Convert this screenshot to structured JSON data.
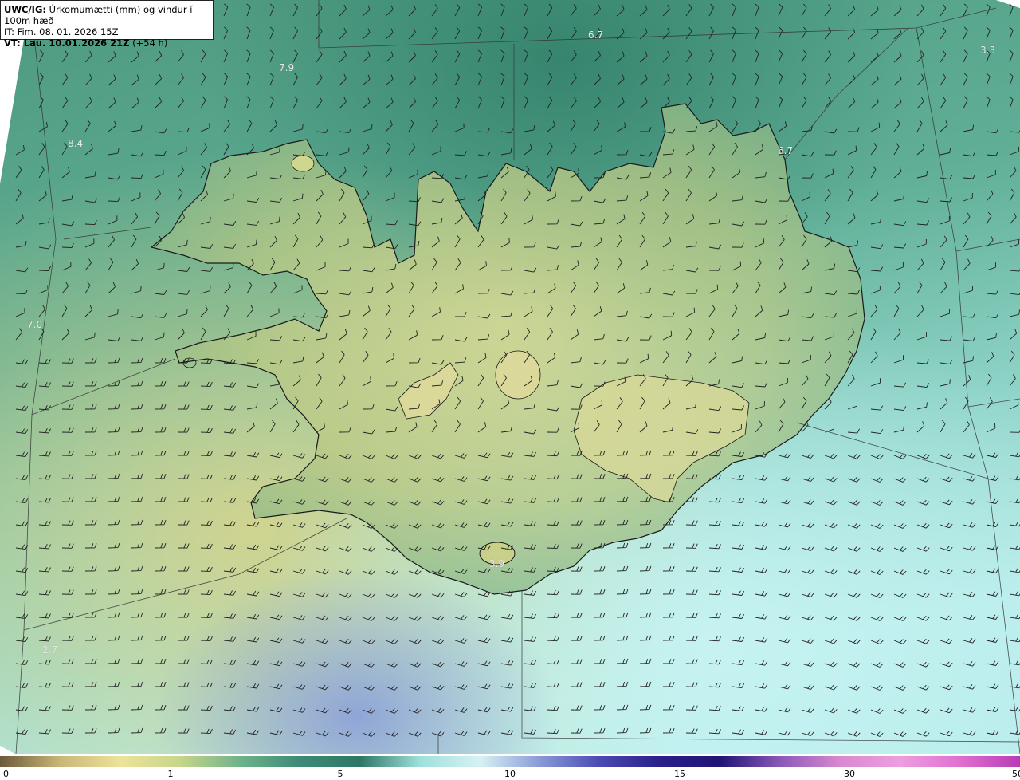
{
  "header": {
    "model_label": "UWC/IG:",
    "product_title": " Úrkomumætti (mm) og vindur í 100m hæð",
    "initial_time": "IT: Fim. 08. 01. 2026 15Z",
    "valid_label": "VT: Lau. 10.01.2026 21Z",
    "valid_offset": " (+54 h)"
  },
  "value_labels": [
    "6.7",
    "3.3",
    "7.9",
    "8.4",
    "6.7",
    "7.0",
    "3.9",
    "2.7"
  ],
  "colorbar": {
    "ticks": [
      "0",
      "1",
      "5",
      "10",
      "15",
      "30",
      "50"
    ],
    "colors": [
      "#6b5a3a",
      "#c9b777",
      "#ede39a",
      "#c7d68a",
      "#6fb38a",
      "#3e8a77",
      "#2e7766",
      "#9fe0dc",
      "#d6f2f2",
      "#8a9ad8",
      "#4a4ab2",
      "#2a1f8a",
      "#1f1473",
      "#8c58b8",
      "#d989cf",
      "#ed9ee0",
      "#e070d0",
      "#b83cb4"
    ]
  }
}
